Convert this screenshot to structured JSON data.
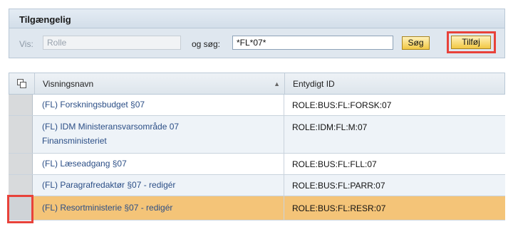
{
  "panel": {
    "title": "Tilgængelig"
  },
  "search": {
    "vis_label": "Vis:",
    "vis_value": "Rolle",
    "search_label": "og søg:",
    "search_value": "*FL*07*",
    "search_button": "Søg",
    "add_button": "Tilføj"
  },
  "table": {
    "columns": {
      "name": "Visningsnavn",
      "id": "Entydigt ID"
    },
    "rows": [
      {
        "name": "(FL) Forskningsbudget §07",
        "id": "ROLE:BUS:FL:FORSK:07"
      },
      {
        "name_line1": "(FL) IDM Ministeransvarsområde 07",
        "name_line2": "Finansministeriet",
        "id": "ROLE:IDM:FL:M:07"
      },
      {
        "name": "(FL) Læseadgang §07",
        "id": "ROLE:BUS:FL:FLL:07"
      },
      {
        "name": "(FL) Paragrafredaktør §07 - redigér",
        "id": "ROLE:BUS:FL:PARR:07"
      },
      {
        "name": "(FL) Resortministerie §07 - redigér",
        "id": "ROLE:BUS:FL:RESR:07"
      }
    ]
  },
  "colors": {
    "highlight": "#f4c478",
    "callout": "#e8423a",
    "link": "#2b4e86"
  },
  "icons": {
    "column_selector": "copy-icon",
    "sort": "sort-ascending-icon"
  }
}
